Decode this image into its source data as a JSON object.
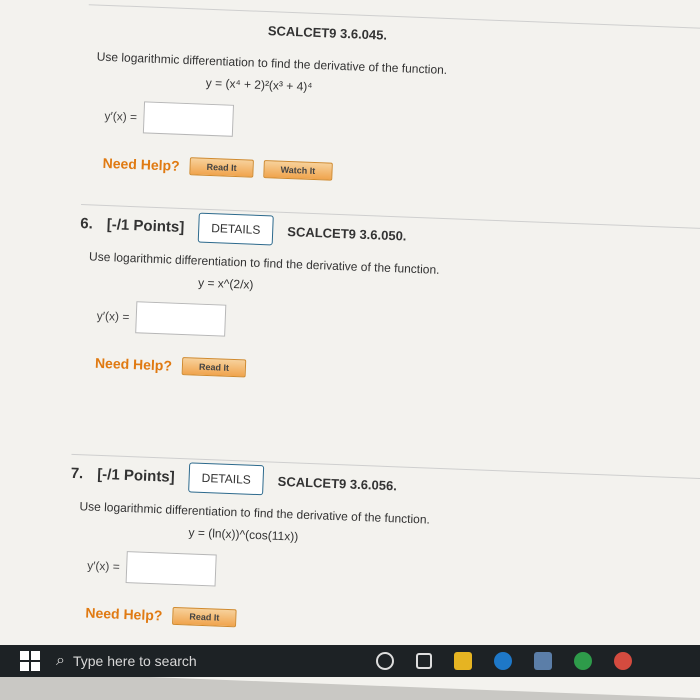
{
  "top_problem": {
    "code": "SCALCET9 3.6.045.",
    "instruction": "Use logarithmic differentiation to find the derivative of the function.",
    "equation": "y = (x⁴ + 2)²(x³ + 4)⁴",
    "answer_label": "y′(x) =",
    "need_help": "Need Help?",
    "buttons": [
      "Read It",
      "Watch It"
    ]
  },
  "problems": [
    {
      "number": "6.",
      "points": "[-/1 Points]",
      "details": "DETAILS",
      "code": "SCALCET9 3.6.050.",
      "instruction": "Use logarithmic differentiation to find the derivative of the function.",
      "equation": "y = x^(2/x)",
      "answer_label": "y′(x) =",
      "need_help": "Need Help?",
      "buttons": [
        "Read It"
      ]
    },
    {
      "number": "7.",
      "points": "[-/1 Points]",
      "details": "DETAILS",
      "code": "SCALCET9 3.6.056.",
      "instruction": "Use logarithmic differentiation to find the derivative of the function.",
      "equation": "y = (ln(x))^(cos(11x))",
      "answer_label": "y′(x) =",
      "need_help": "Need Help?",
      "buttons": [
        "Read It"
      ]
    }
  ],
  "taskbar": {
    "search_placeholder": "Type here to search"
  }
}
